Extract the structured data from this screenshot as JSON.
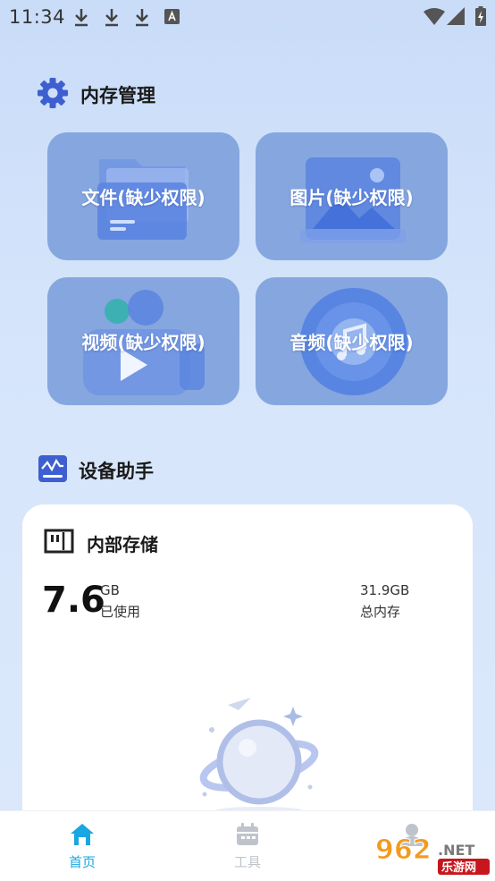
{
  "status_bar": {
    "time": "11:34",
    "icons": [
      "download-icon",
      "download-icon",
      "download-icon",
      "a-badge-icon",
      "wifi-icon",
      "signal-icon",
      "battery-charging-icon"
    ]
  },
  "memory_section": {
    "title": "内存管理",
    "icon": "gear-icon",
    "accent": "#3d5fd0"
  },
  "tiles": [
    {
      "label": "文件(缺少权限)",
      "icon": "folder-icon"
    },
    {
      "label": "图片(缺少权限)",
      "icon": "image-icon"
    },
    {
      "label": "视频(缺少权限)",
      "icon": "video-icon"
    },
    {
      "label": "音频(缺少权限)",
      "icon": "music-icon"
    }
  ],
  "device_section": {
    "title": "设备助手",
    "icon": "monitor-chart-icon"
  },
  "storage_card": {
    "title": "内部存储",
    "icon": "sd-card-icon",
    "used_value": "7.6",
    "used_unit": "GB",
    "used_label": "已使用",
    "total_value": "31.9GB",
    "total_label": "总内存"
  },
  "bottom_nav": {
    "items": [
      {
        "label": "首页",
        "icon": "home-icon",
        "active": true
      },
      {
        "label": "工具",
        "icon": "calendar-icon",
        "active": false
      },
      {
        "label": "",
        "icon": "profile-icon",
        "active": false
      }
    ],
    "active_color": "#1aa6e0",
    "inactive_color": "#bfc4cc"
  },
  "watermark": {
    "brand": "962",
    "suffix": ".NET",
    "subtitle": "乐游网"
  }
}
